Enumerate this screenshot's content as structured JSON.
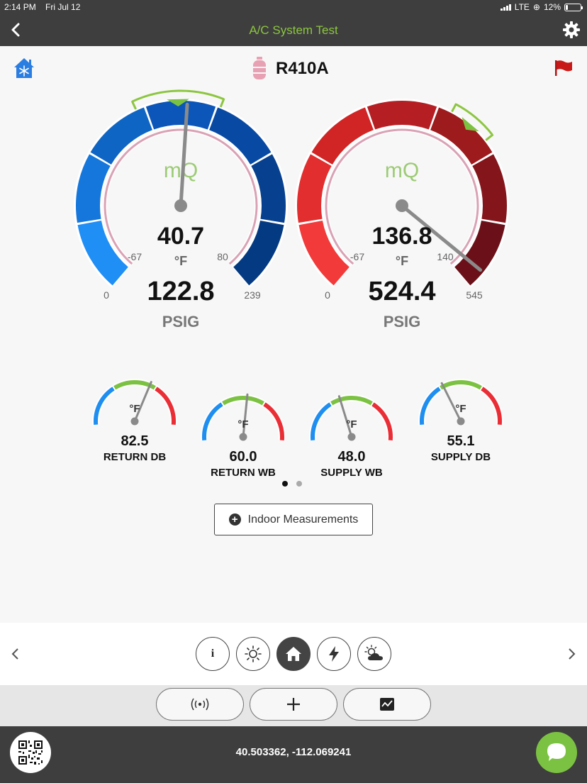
{
  "status": {
    "time": "2:14 PM",
    "date": "Fri Jul 12",
    "network": "LTE",
    "battery": "12%"
  },
  "nav": {
    "title": "A/C System Test"
  },
  "header": {
    "refrigerant": "R410A"
  },
  "low_side": {
    "temp": "40.7",
    "temp_unit": "°F",
    "temp_min": "-67",
    "temp_max": "80",
    "pressure": "122.8",
    "pressure_unit": "PSIG",
    "pressure_min": "0",
    "pressure_max": "239",
    "logo": "mQ",
    "needle_fraction": 0.513
  },
  "high_side": {
    "temp": "136.8",
    "temp_unit": "°F",
    "temp_min": "-67",
    "temp_max": "140",
    "pressure": "524.4",
    "pressure_unit": "PSIG",
    "pressure_min": "0",
    "pressure_max": "545",
    "logo": "mQ",
    "needle_fraction": 0.962
  },
  "mini_gauges": [
    {
      "name": "RETURN DB",
      "value": "82.5",
      "unit": "°F",
      "needle_fraction": 0.62
    },
    {
      "name": "RETURN WB",
      "value": "60.0",
      "unit": "°F",
      "needle_fraction": 0.53
    },
    {
      "name": "SUPPLY WB",
      "value": "48.0",
      "unit": "°F",
      "needle_fraction": 0.41
    },
    {
      "name": "SUPPLY DB",
      "value": "55.1",
      "unit": "°F",
      "needle_fraction": 0.36
    }
  ],
  "indoor_button": {
    "label": "Indoor Measurements"
  },
  "mode_tabs": [
    {
      "name": "info",
      "label": "i"
    },
    {
      "name": "sun",
      "label": ""
    },
    {
      "name": "home",
      "label": ""
    },
    {
      "name": "power",
      "label": ""
    },
    {
      "name": "weather",
      "label": ""
    }
  ],
  "footer": {
    "coordinates": "40.503362, -112.069241"
  },
  "colors": {
    "accent_green": "#8cc63f",
    "dark_bar": "#3e3e3e",
    "low_blue": "#0b56b8",
    "high_red": "#b51f24"
  }
}
